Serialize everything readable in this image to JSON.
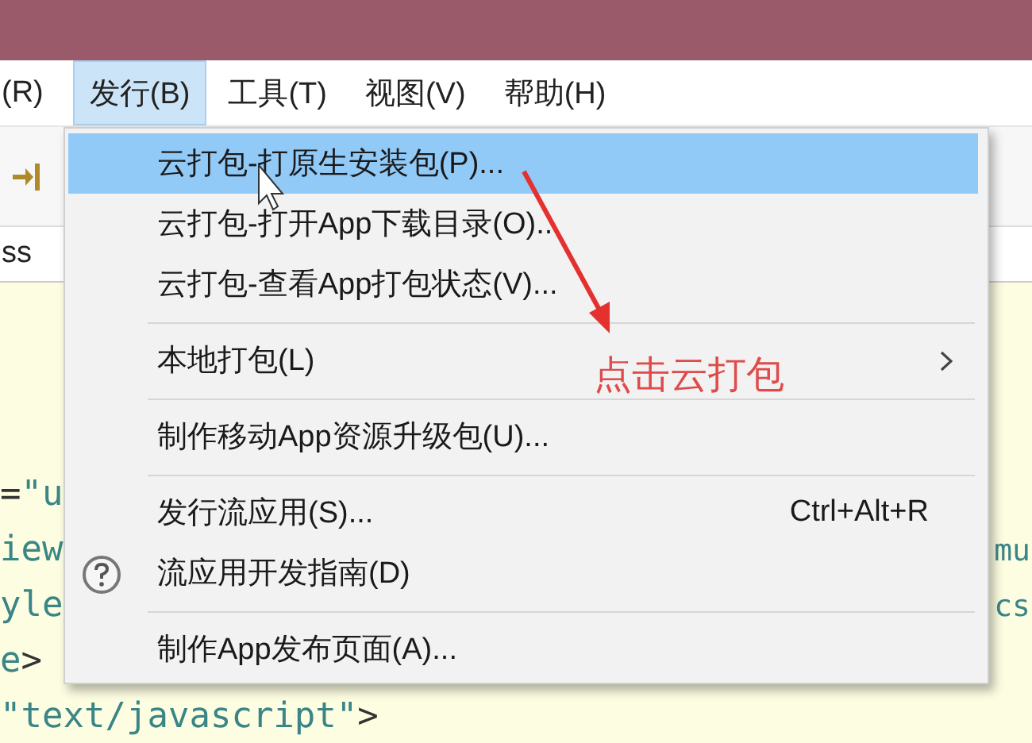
{
  "menubar": [
    {
      "label": "(R)",
      "selected": false
    },
    {
      "label": "发行(B)",
      "selected": true
    },
    {
      "label": "工具(T)",
      "selected": false
    },
    {
      "label": "视图(V)",
      "selected": false
    },
    {
      "label": "帮助(H)",
      "selected": false
    }
  ],
  "editor_tab": {
    "label": "ss"
  },
  "code_lines": [
    {
      "segments": [
        {
          "kind": "punct",
          "text": "="
        },
        {
          "kind": "string",
          "text": "\"u"
        }
      ]
    },
    {
      "segments": [
        {
          "kind": "string",
          "text": "iew"
        }
      ],
      "right": "mu"
    },
    {
      "segments": [
        {
          "kind": "string",
          "text": "yle"
        }
      ],
      "right": "cs"
    },
    {
      "segments": [
        {
          "kind": "string",
          "text": "e"
        },
        {
          "kind": "punct",
          "text": ">"
        }
      ]
    },
    {
      "segments": [
        {
          "kind": "string",
          "text": "\"text/javascript\""
        },
        {
          "kind": "punct",
          "text": ">"
        }
      ]
    }
  ],
  "menu": {
    "items": [
      {
        "kind": "item",
        "label": "云打包-打原生安装包(P)...",
        "selected": true,
        "has_submenu": false
      },
      {
        "kind": "item",
        "label": "云打包-打开App下载目录(O)...",
        "selected": false,
        "has_submenu": false
      },
      {
        "kind": "item",
        "label": "云打包-查看App打包状态(V)...",
        "selected": false,
        "has_submenu": false
      },
      {
        "kind": "separator"
      },
      {
        "kind": "item",
        "label": "本地打包(L)",
        "selected": false,
        "has_submenu": true
      },
      {
        "kind": "separator"
      },
      {
        "kind": "item",
        "label": "制作移动App资源升级包(U)...",
        "selected": false,
        "has_submenu": false
      },
      {
        "kind": "separator"
      },
      {
        "kind": "item",
        "label": "发行流应用(S)...",
        "shortcut": "Ctrl+Alt+R",
        "selected": false,
        "has_submenu": false
      },
      {
        "kind": "help_item",
        "label": "流应用开发指南(D)",
        "selected": false,
        "has_submenu": false
      },
      {
        "kind": "separator"
      },
      {
        "kind": "item",
        "label": "制作App发布页面(A)...",
        "selected": false,
        "has_submenu": false
      }
    ]
  },
  "annotation": {
    "text": "点击云打包"
  }
}
